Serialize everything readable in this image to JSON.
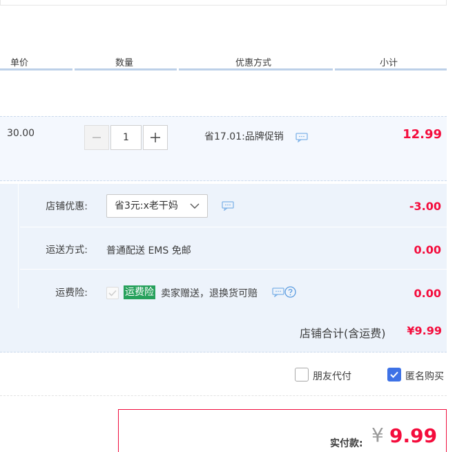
{
  "header": {
    "columns": [
      {
        "label": "单价"
      },
      {
        "label": "数量"
      },
      {
        "label": "优惠方式"
      },
      {
        "label": "小计"
      }
    ]
  },
  "item": {
    "unit_price": "30.00",
    "quantity": "1",
    "decrement_symbol": "—",
    "increment_symbol": "+",
    "promotion": "省17.01:品牌促销",
    "subtotal": "12.99"
  },
  "shop": {
    "discount_label": "店铺优惠:",
    "discount_selected": "省3元:x老干妈",
    "discount_amount": "-3.00",
    "shipping_label": "运送方式:",
    "shipping_value": "普通配送 EMS 免邮",
    "shipping_amount": "0.00",
    "insurance_label": "运费险:",
    "insurance_tag": "运费险",
    "insurance_text": "卖家赠送，退换货可赔",
    "insurance_amount": "0.00",
    "total_label": "店铺合计(含运费)",
    "total_value": "¥9.99"
  },
  "options": {
    "friend_pay_label": "朋友代付",
    "friend_pay_checked": false,
    "anonymous_label": "匿名购买",
    "anonymous_checked": true
  },
  "payment": {
    "label": "实付款:",
    "currency": "¥",
    "amount": "9.99"
  },
  "colors": {
    "accent_red": "#f40c3c",
    "insurance_green": "#27a15c",
    "checkbox_blue": "#3e72e6",
    "row_bg": "#edf3fb"
  },
  "icons": {
    "chat": "chat-bubble-icon",
    "help": "question-circle-icon",
    "chevron": "chevron-down-icon",
    "check": "check-icon"
  }
}
